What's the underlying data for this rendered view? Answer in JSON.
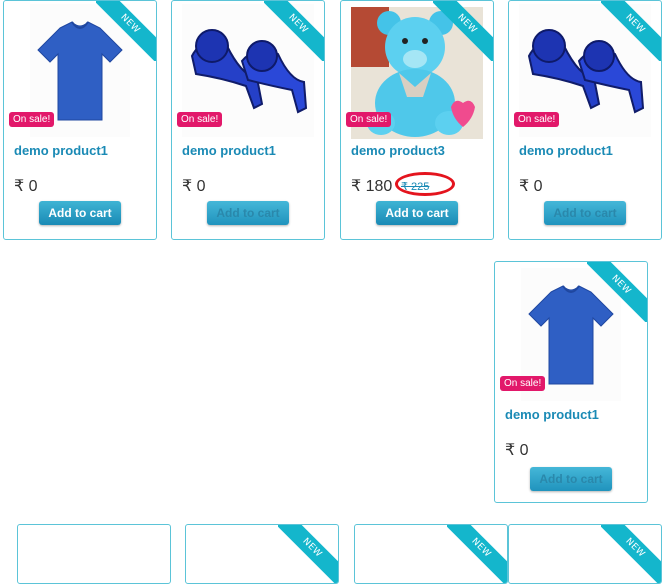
{
  "products": [
    {
      "name": "demo product1",
      "price": "₹ 0",
      "sale": "On sale!",
      "ribbon": "NEW",
      "button": "Add to cart"
    },
    {
      "name": "demo product1",
      "price": "₹ 0",
      "sale": "On sale!",
      "ribbon": "NEW",
      "button": "Add to cart"
    },
    {
      "name": "demo product3",
      "price": "₹ 180",
      "old_price": "₹ 225",
      "sale": "On sale!",
      "ribbon": "NEW",
      "button": "Add to cart"
    },
    {
      "name": "demo product1",
      "price": "₹ 0",
      "sale": "On sale!",
      "ribbon": "NEW",
      "button": "Add to cart"
    },
    {
      "name": "demo product1",
      "price": "₹ 0",
      "sale": "On sale!",
      "ribbon": "NEW",
      "button": "Add to cart"
    }
  ],
  "bottom_ribbons": [
    "NEW",
    "NEW",
    "NEW"
  ],
  "colors": {
    "accent": "#1a8ab5",
    "ribbon": "#14b6cc",
    "sale": "#e2186a",
    "highlight": "#e4141e",
    "border": "#5bc4d8"
  }
}
